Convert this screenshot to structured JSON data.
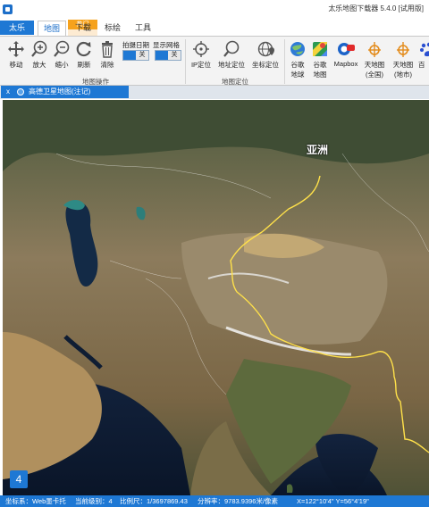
{
  "window": {
    "title": "太乐地图下载器 5.4.0 [试用版]"
  },
  "tabs": {
    "app": "太乐",
    "map": "地图",
    "hot_badge": "热门",
    "download": "下载",
    "mark": "标绘",
    "tools": "工具"
  },
  "ribbon": {
    "map_ops": {
      "move": "移动",
      "zoom_in": "放大",
      "zoom_out": "缩小",
      "refresh": "刷新",
      "clear": "清除",
      "capture_date_label": "拍摄日期",
      "capture_date_state": "关",
      "show_grid_label": "显示网格",
      "show_grid_state": "关",
      "group_label": "地图操作"
    },
    "locate": {
      "ip": "IP定位",
      "address": "地址定位",
      "coord": "坐标定位",
      "group_label": "地图定位"
    },
    "sources": {
      "google_earth_1": "谷歌",
      "google_earth_2": "地球",
      "google_map_1": "谷歌",
      "google_map_2": "地图",
      "mapbox": "Mapbox",
      "tianditu_all_1": "天地图",
      "tianditu_all_2": "(全国)",
      "tianditu_city_1": "天地图",
      "tianditu_city_2": "(地市)",
      "baidu_partial": "百"
    }
  },
  "document_tab": {
    "close": "x",
    "title": "高德卫星地图(注记)"
  },
  "map": {
    "region_label": "亚洲",
    "zoom_level_badge": "4"
  },
  "status": {
    "coord_system": "坐标系：Web墨卡托",
    "level": "当前级别：4",
    "scale": "比例尺：1/3697869.43",
    "resolution": "分辨率：9783.9396米/像素",
    "cursor": "X=122°10'4\"   Y=56°4'19\""
  },
  "colors": {
    "accent": "#1e78d4",
    "hot": "#f6a21c",
    "border_line": "#ffe14a"
  }
}
